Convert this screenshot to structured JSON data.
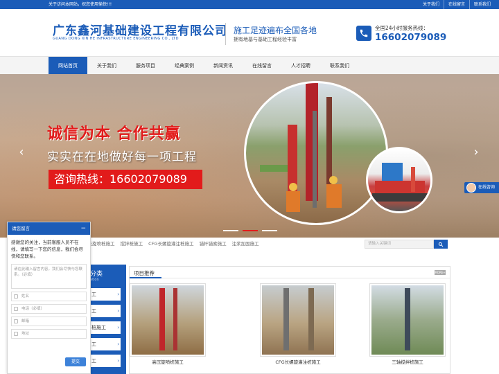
{
  "topbar": {
    "welcome": "关于访问本网站，祝您使用愉快!!!",
    "links": [
      "关于我们",
      "在线留言",
      "联系我们"
    ]
  },
  "header": {
    "company_cn": "广东鑫河基础建设工程有限公司",
    "company_en": "GUANG DONG XIN HE INFRASTRUCTURE ENGINEERING CO., LTD",
    "slogan": "施工足迹遍布全国各地",
    "slogan_sub": "拥有地基与基础工程经验丰富",
    "hotline_label": "全国24小时服务热线：",
    "hotline_number": "16602079089"
  },
  "nav": {
    "items": [
      "网站首页",
      "关于我们",
      "服务项目",
      "经典案例",
      "新闻资讯",
      "在线留言",
      "人才招聘",
      "联系我们"
    ],
    "active": "网站首页"
  },
  "banner": {
    "tagline_1": "诚信为本 合作共赢",
    "tagline_2": "实实在在地做好每一项工程",
    "hotline": "咨询热线：16602079089",
    "prev": "‹",
    "next": "›",
    "slide_count": 3,
    "active_slide": 2
  },
  "float_consult": {
    "label": "在线咨询"
  },
  "keywords": [
    "高压旋喷桩施工",
    "搅拌桩施工",
    "CFG长螺旋灌注桩施工",
    "锚杆锚索施工",
    "注浆加固施工"
  ],
  "search": {
    "placeholder": "请输入关键词"
  },
  "category": {
    "title": "分类",
    "subtitle": "ation",
    "items": [
      "工",
      "工",
      "桩施工",
      "工",
      "工"
    ]
  },
  "products": {
    "section_title": "项目推荐",
    "more": "MORE+",
    "items": [
      {
        "caption": "高压旋喷桩施工"
      },
      {
        "caption": "CFG长螺旋灌注桩施工"
      },
      {
        "caption": "三轴搅拌桩施工"
      }
    ]
  },
  "chat": {
    "header": "请您留言",
    "minimize": "−",
    "message": "感谢您的关注，当前客服人员不在线，请填写一下您的信息，我们会尽快和您联系。",
    "textarea_placeholder": "请在此输入留言内容，我们会尽快与您联系。（必填）",
    "fields": [
      "姓名",
      "电话（必填）",
      "邮箱",
      "地址"
    ],
    "submit": "提交"
  },
  "colors": {
    "brand_blue": "#1b5cb8",
    "accent_red": "#e21b1b"
  }
}
